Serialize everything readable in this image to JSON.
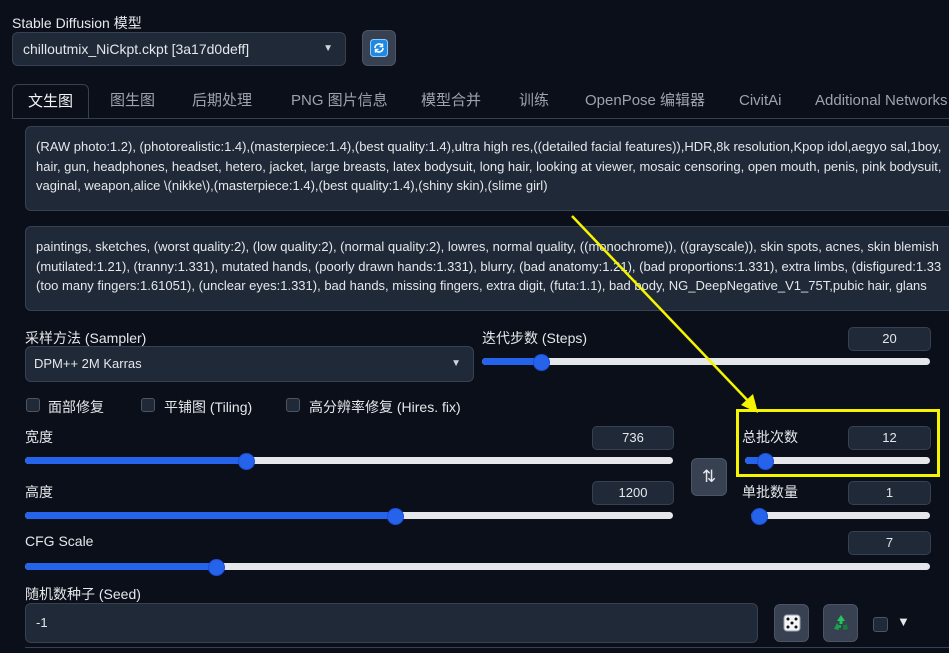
{
  "model": {
    "label": "Stable Diffusion 模型",
    "selected": "chilloutmix_NiCkpt.ckpt [3a17d0deff]"
  },
  "tabs": [
    {
      "label": "文生图",
      "active": true
    },
    {
      "label": "图生图"
    },
    {
      "label": "后期处理"
    },
    {
      "label": "PNG 图片信息"
    },
    {
      "label": "模型合并"
    },
    {
      "label": "训练"
    },
    {
      "label": "OpenPose 编辑器"
    },
    {
      "label": "CivitAi"
    },
    {
      "label": "Additional Networks"
    }
  ],
  "prompt": {
    "text": "(RAW photo:1.2), (photorealistic:1.4),(masterpiece:1.4),(best quality:1.4),ultra high res,((detailed facial features)),HDR,8k resolution,Kpop idol,aegyo sal,1boy,\nhair, gun, headphones, headset, hetero, jacket, large breasts, latex bodysuit, long hair, looking at viewer, mosaic censoring, open mouth, penis, pink bodysuit,\nvaginal, weapon,alice \\(nikke\\),(masterpiece:1.4),(best quality:1.4),(shiny skin),(slime girl)"
  },
  "negative_prompt": {
    "text": "paintings, sketches, (worst quality:2), (low quality:2), (normal quality:2), lowres, normal quality, ((monochrome)), ((grayscale)), skin spots, acnes, skin blemish\n(mutilated:1.21), (tranny:1.331), mutated hands, (poorly drawn hands:1.331), blurry, (bad anatomy:1.21), (bad proportions:1.331), extra limbs, (disfigured:1.33\n(too many fingers:1.61051), (unclear eyes:1.331), bad hands, missing fingers, extra digit, (futa:1.1), bad body, NG_DeepNegative_V1_75T,pubic hair, glans"
  },
  "sampler": {
    "label": "采样方法 (Sampler)",
    "selected": "DPM++ 2M Karras"
  },
  "steps": {
    "label": "迭代步数 (Steps)",
    "value": "20",
    "fraction": 0.13
  },
  "checkboxes": [
    {
      "label": "面部修复",
      "checked": false
    },
    {
      "label": "平铺图 (Tiling)",
      "checked": false
    },
    {
      "label": "高分辨率修复 (Hires. fix)",
      "checked": false
    }
  ],
  "width": {
    "label": "宽度",
    "value": "736",
    "fraction": 0.34
  },
  "height": {
    "label": "高度",
    "value": "1200",
    "fraction": 0.57
  },
  "batch_count": {
    "label": "总批次数",
    "value": "12",
    "fraction": 0.1
  },
  "batch_size": {
    "label": "单批数量",
    "value": "1",
    "fraction": 0.0
  },
  "cfg_scale": {
    "label": "CFG Scale",
    "value": "7",
    "fraction": 0.21
  },
  "seed": {
    "label": "随机数种子 (Seed)",
    "value": "-1"
  },
  "icons": {
    "refresh": "refresh-icon",
    "swap": "swap-arrows-icon",
    "dice": "dice-icon",
    "recycle": "recycle-icon"
  },
  "colors": {
    "background": "#0b0f19",
    "accent": "#2563eb",
    "annotation": "#f5f500"
  }
}
